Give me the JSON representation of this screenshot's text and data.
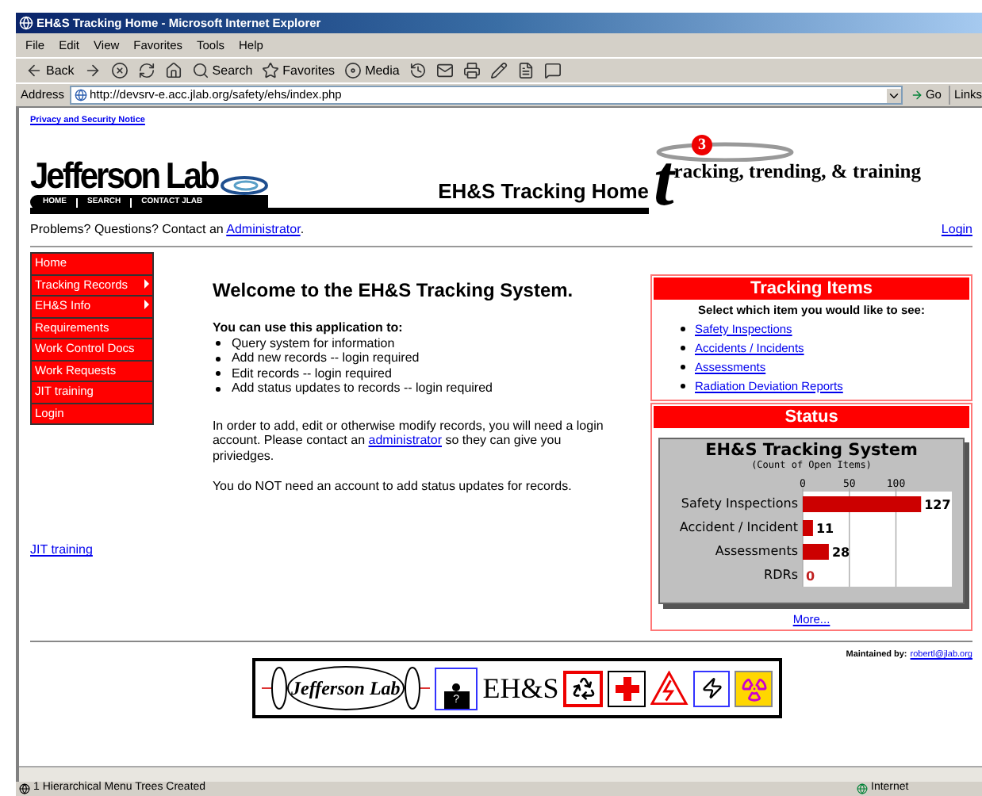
{
  "window": {
    "title": "EH&S Tracking Home - Microsoft Internet Explorer"
  },
  "menu_bar": [
    "File",
    "Edit",
    "View",
    "Favorites",
    "Tools",
    "Help"
  ],
  "toolbar": [
    {
      "kind": "back",
      "label": "Back"
    },
    {
      "kind": "forward"
    },
    {
      "kind": "stop"
    },
    {
      "kind": "refresh"
    },
    {
      "kind": "home"
    },
    {
      "kind": "search",
      "label": "Search"
    },
    {
      "kind": "favorites",
      "label": "Favorites"
    },
    {
      "kind": "media",
      "label": "Media"
    },
    {
      "kind": "history"
    },
    {
      "kind": "mail"
    },
    {
      "kind": "print"
    },
    {
      "kind": "edit"
    },
    {
      "kind": "page"
    },
    {
      "kind": "discuss"
    }
  ],
  "address_bar": {
    "label": "Address",
    "url": "http://devsrv-e.acc.jlab.org/safety/ehs/index.php",
    "go": "Go",
    "links": "Links"
  },
  "page": {
    "privacy_link": "Privacy and Security Notice",
    "logo": {
      "name": "Jefferson Lab",
      "nav": [
        "HOME",
        "SEARCH",
        "CONTACT JLAB"
      ]
    },
    "page_title": "EH&S Tracking Home",
    "t3_logo": {
      "big_letter": "t",
      "badge": "3",
      "text": "racking, **t**rending, & **t**raining"
    },
    "contact": {
      "text": "Problems? Questions? Contact an",
      "link": "Administrator",
      "end": "."
    },
    "login_link": "Login",
    "sidebar": [
      {
        "label": "Home",
        "submenu": false
      },
      {
        "label": "Tracking Records",
        "submenu": true
      },
      {
        "label": "EH&S Info",
        "submenu": true
      },
      {
        "label": "Requirements",
        "submenu": false
      },
      {
        "label": "Work Control Docs",
        "submenu": false
      },
      {
        "label": "Work Requests",
        "submenu": false
      },
      {
        "label": "JIT training",
        "submenu": false
      },
      {
        "label": "Login",
        "submenu": false
      }
    ],
    "jit_link": "JIT training",
    "welcome": {
      "heading": "Welcome to the EH&S Tracking System.",
      "lead": "You can use this application to:",
      "bullets": [
        "Query system for information",
        "Add new records -- login required",
        "Edit records -- login required",
        "Add status updates to records -- login required"
      ],
      "para_before": "In order to add, edit or otherwise modify records, you will need a login account. Please contact an",
      "para_link": "administrator",
      "para_after": "so they can give you priviedges.",
      "note": "You do NOT need an account to add status updates for records."
    },
    "tracking_items": {
      "title": "Tracking Items",
      "prompt": "Select which item you would like to see:",
      "links": [
        "Safety Inspections",
        "Accidents / Incidents",
        "Assessments",
        "Radiation Deviation Reports"
      ]
    },
    "status": {
      "title": "Status",
      "more_link": "More...",
      "chart_data": {
        "type": "bar",
        "orientation": "horizontal",
        "title": "EH&S Tracking System",
        "xlabel": "(Count of Open Items)",
        "categories": [
          "Safety Inspections",
          "Accident / Incident",
          "Assessments",
          "RDRs"
        ],
        "series": [
          {
            "color": "#cc0000",
            "values": [
              127,
              11,
              28,
              0
            ]
          }
        ],
        "xlim": [
          0,
          160
        ],
        "xticks": [
          0,
          50,
          100
        ],
        "data_labels": true
      }
    },
    "footer": {
      "maintained": "Maintained by:",
      "email": "robertl@jlab.org",
      "banner_logo": "Jefferson Lab",
      "banner_help": "?",
      "banner_text": "EH&S"
    }
  },
  "status_bar": {
    "text": "1 Hierarchical Menu Trees Created",
    "zone": "Internet"
  }
}
